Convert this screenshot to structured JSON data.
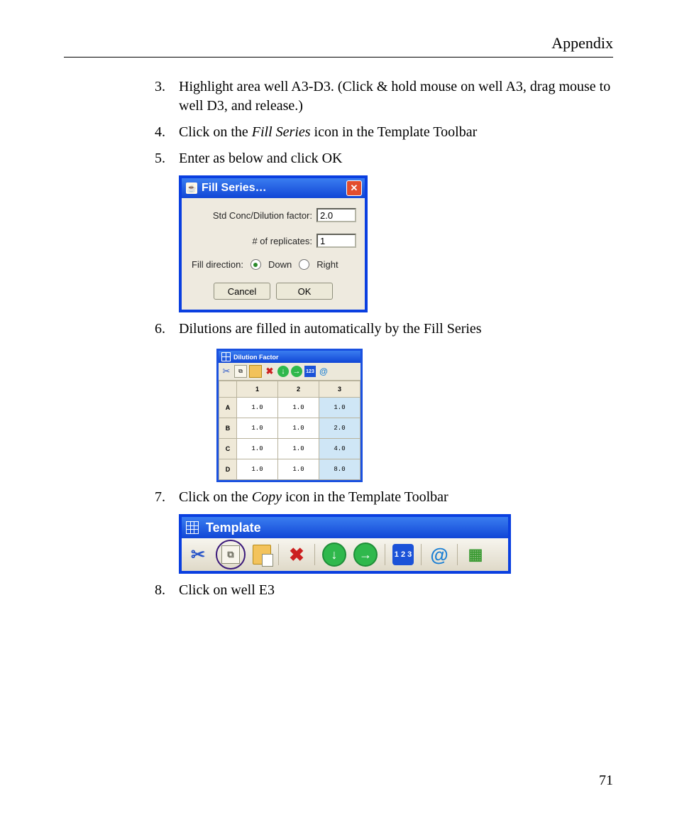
{
  "header": {
    "section": "Appendix"
  },
  "steps": {
    "three": "Highlight area well A3-D3. (Click & hold mouse on well A3, drag mouse to well D3, and release.)",
    "four_pre": "Click on the ",
    "four_em": "Fill Series",
    "four_post": " icon in the Template Toolbar",
    "five": "Enter as below and click OK",
    "six": "Dilutions are filled in automatically by the Fill Series",
    "seven_pre": "Click on the ",
    "seven_em": "Copy",
    "seven_post": " icon in the Template Toolbar",
    "eight": "Click on well E3"
  },
  "fill_series_dialog": {
    "title": "Fill Series…",
    "field1_label": "Std Conc/Dilution factor:",
    "field1_value": "2.0",
    "field2_label": "# of replicates:",
    "field2_value": "1",
    "direction_label": "Fill direction:",
    "option_down": "Down",
    "option_right": "Right",
    "cancel": "Cancel",
    "ok": "OK"
  },
  "dilution_window": {
    "title": "Dilution Factor",
    "cols": {
      "c1": "1",
      "c2": "2",
      "c3": "3"
    },
    "rows": {
      "A": {
        "label": "A",
        "c1": "1.0",
        "c2": "1.0",
        "c3": "1.0"
      },
      "B": {
        "label": "B",
        "c1": "1.0",
        "c2": "1.0",
        "c3": "2.0"
      },
      "C": {
        "label": "C",
        "c1": "1.0",
        "c2": "1.0",
        "c3": "4.0"
      },
      "D": {
        "label": "D",
        "c1": "1.0",
        "c2": "1.0",
        "c3": "8.0"
      }
    }
  },
  "template_toolbar": {
    "title": "Template"
  },
  "icons": {
    "java": "☕",
    "close": "✕",
    "cut": "✂",
    "copy": "⧉",
    "delete": "✖",
    "down": "↓",
    "right": "→",
    "onetwothree": "1 2 3",
    "at": "@",
    "grids": "▦"
  },
  "page_number": "71"
}
